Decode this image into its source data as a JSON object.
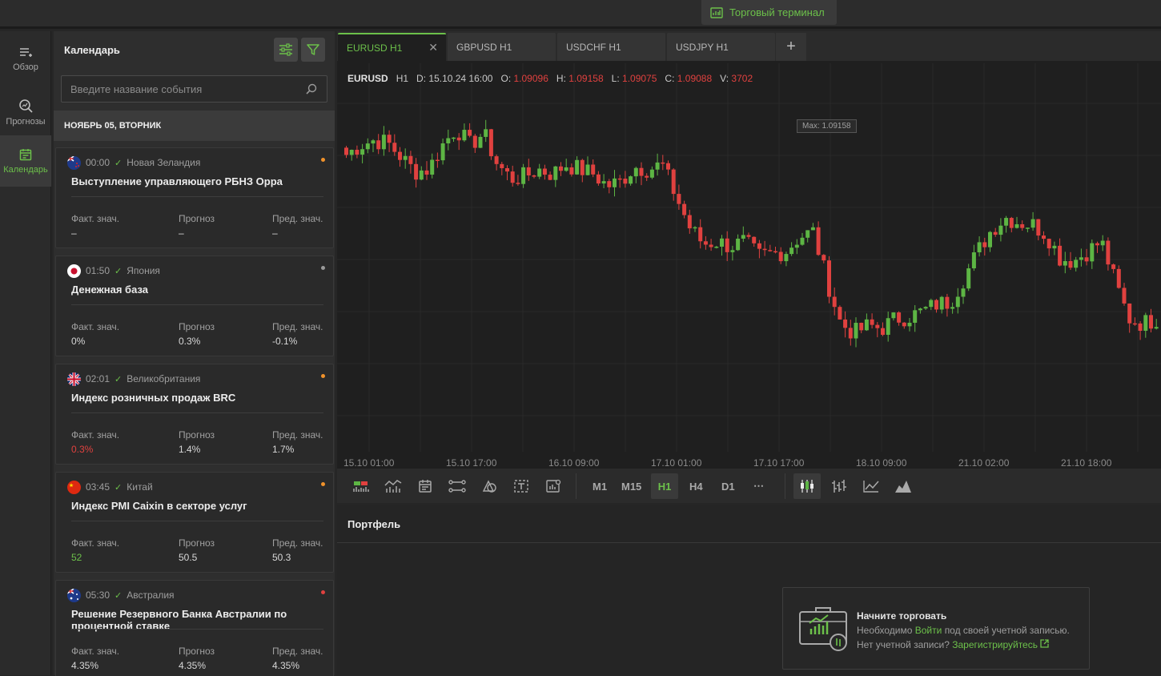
{
  "topbar": {
    "terminal_label": "Торговый терминал"
  },
  "leftnav": {
    "items": [
      {
        "label": "Обзор",
        "icon": "overview-list-icon",
        "active": false
      },
      {
        "label": "Прогнозы",
        "icon": "forecast-magnifier-icon",
        "active": false
      },
      {
        "label": "Календарь",
        "icon": "calendar-icon",
        "active": true
      }
    ]
  },
  "calendar": {
    "title": "Календарь",
    "search_placeholder": "Введите название события",
    "date_header": "НОЯБРЬ 05, ВТОРНИК",
    "col_actual": "Факт. знач.",
    "col_forecast": "Прогноз",
    "col_previous": "Пред. знач.",
    "events": [
      {
        "time": "00:00",
        "country": "Новая Зеландия",
        "flag": "new-zealand-flag",
        "title": "Выступление управляющего РБНЗ Орра",
        "actual": "–",
        "forecast": "–",
        "previous": "–",
        "actual_color": "#d7d7d7",
        "importance_color": "#f0922b"
      },
      {
        "time": "01:50",
        "country": "Япония",
        "flag": "japan-flag",
        "title": "Денежная база",
        "actual": "0%",
        "forecast": "0.3%",
        "previous": "-0.1%",
        "actual_color": "#d7d7d7",
        "importance_color": "#9a9a9a"
      },
      {
        "time": "02:01",
        "country": "Великобритания",
        "flag": "uk-flag",
        "title": "Индекс розничных продаж BRC",
        "actual": "0.3%",
        "forecast": "1.4%",
        "previous": "1.7%",
        "actual_color": "#e0413f",
        "importance_color": "#f0922b"
      },
      {
        "time": "03:45",
        "country": "Китай",
        "flag": "china-flag",
        "title": "Индекс PMI Caixin в секторе услуг",
        "actual": "52",
        "forecast": "50.5",
        "previous": "50.3",
        "actual_color": "#6cc04a",
        "importance_color": "#f0922b"
      },
      {
        "time": "05:30",
        "country": "Австралия",
        "flag": "australia-flag",
        "title": "Решение Резервного Банка Австралии по процентной ставке",
        "actual": "4.35%",
        "forecast": "4.35%",
        "previous": "4.35%",
        "actual_color": "#d7d7d7",
        "importance_color": "#e0413f"
      }
    ]
  },
  "chart": {
    "tabs": [
      {
        "label": "EURUSD H1",
        "active": true
      },
      {
        "label": "GBPUSD H1",
        "active": false
      },
      {
        "label": "USDCHF H1",
        "active": false
      },
      {
        "label": "USDJPY H1",
        "active": false
      }
    ],
    "add_tab_label": "+",
    "ohlc": {
      "symbol": "EURUSD",
      "timeframe": "H1",
      "date_label": "D:",
      "date": "15.10.24 16:00",
      "open_label": "O:",
      "open": "1.09096",
      "high_label": "H:",
      "high": "1.09158",
      "low_label": "L:",
      "low": "1.09075",
      "close_label": "C:",
      "close": "1.09088",
      "volume_label": "V:",
      "volume": "3702"
    },
    "max_label": "Max: 1.09158",
    "toolbar": {
      "timeframes": [
        "M1",
        "M15",
        "H1",
        "H4",
        "D1"
      ],
      "active_timeframe": "H1",
      "more": "⋯"
    },
    "colors": {
      "bull": "#5db544",
      "bear": "#e0413f",
      "accent": "#6cc04a"
    }
  },
  "chart_data": {
    "type": "candlestick",
    "symbol": "EURUSD",
    "timeframe": "H1",
    "x_ticks": [
      "15.10 01:00",
      "15.10 17:00",
      "16.10 09:00",
      "17.10 01:00",
      "17.10 17:00",
      "18.10 09:00",
      "21.10 02:00",
      "21.10 18:00"
    ],
    "close_path": [
      1.09,
      1.0904,
      1.0906,
      1.0905,
      1.0899,
      1.0893,
      1.0894,
      1.0904,
      1.0911,
      1.0904,
      1.0909,
      1.0896,
      1.089,
      1.0891,
      1.0894,
      1.0892,
      1.0896,
      1.0894,
      1.0892,
      1.0887,
      1.0889,
      1.0895,
      1.0894,
      1.0896,
      1.0883,
      1.087,
      1.0863,
      1.0864,
      1.0862,
      1.0864,
      1.0858,
      1.0859,
      1.086,
      1.0866,
      1.0868,
      1.0848,
      1.083,
      1.0826,
      1.0829,
      1.0828,
      1.0832,
      1.0833,
      1.0835,
      1.0838,
      1.0839,
      1.0849,
      1.086,
      1.0869,
      1.0874,
      1.0872,
      1.0871,
      1.0867,
      1.0857,
      1.0856,
      1.086,
      1.0864,
      1.0847,
      1.0832,
      1.083,
      1.0832
    ],
    "price_max": 1.09158
  },
  "portfolio": {
    "title": "Портфель",
    "start_title": "Начните торговать",
    "line1_pre": "Необходимо",
    "line1_link": "Войти",
    "line1_post": "под своей учетной записью.",
    "line2_pre": "Нет учетной записи?",
    "line2_link": "Зарегистрируйтесь"
  }
}
